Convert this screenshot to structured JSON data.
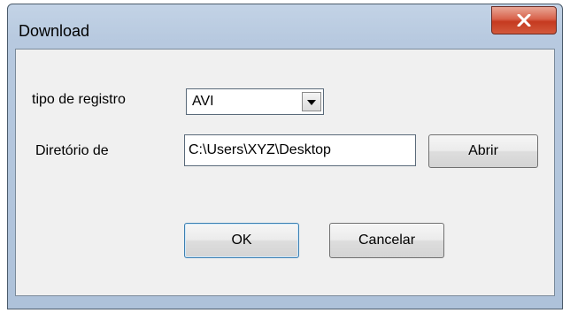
{
  "window": {
    "title": "Download"
  },
  "form": {
    "record_type_label": "tipo de registro",
    "record_type_value": "AVI",
    "directory_label": "Diretório de",
    "directory_value": "C:\\Users\\XYZ\\Desktop"
  },
  "buttons": {
    "open_label": "Abrir",
    "ok_label": "OK",
    "cancel_label": "Cancelar"
  },
  "icons": {
    "close": "close-icon",
    "dropdown": "chevron-down-icon"
  },
  "colors": {
    "close_button": "#c53a20",
    "frame": "#b7c9df",
    "client_background": "#f0f0f0"
  }
}
